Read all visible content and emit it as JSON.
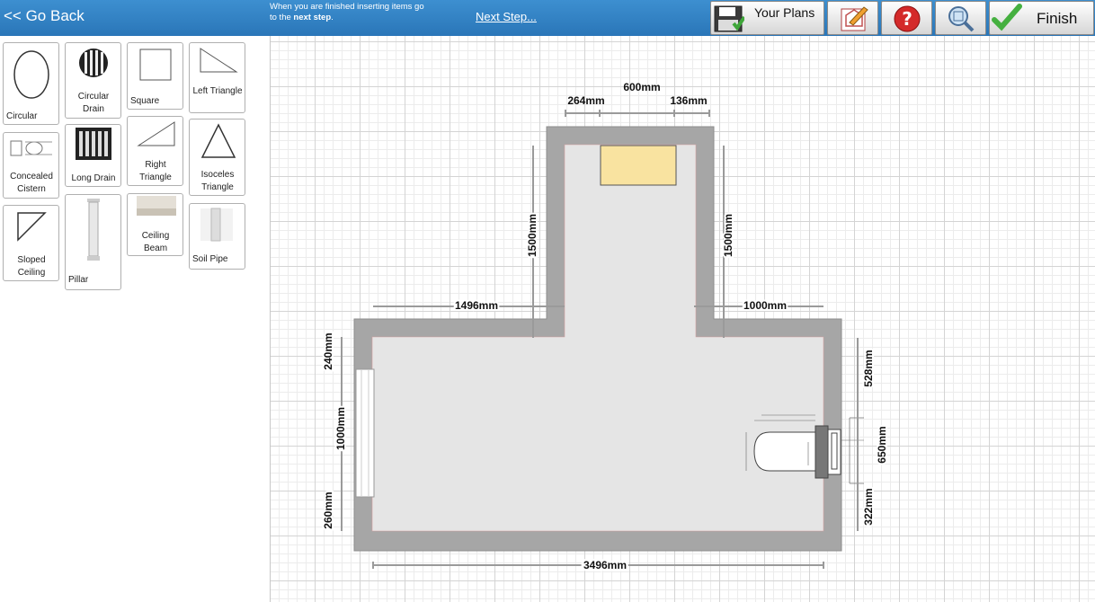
{
  "topbar": {
    "go_back": "<< Go Back",
    "hint_line1": "When you are finished inserting items go",
    "hint_line2_prefix": "to the ",
    "hint_line2_bold": "next step",
    "hint_line2_suffix": ".",
    "next_step": "Next Step...",
    "your_plans": "Your Plans",
    "finish": "Finish"
  },
  "sidebar": {
    "items": [
      {
        "label": "Circular"
      },
      {
        "label": "Circular Drain"
      },
      {
        "label": "Square"
      },
      {
        "label": "Left Triangle"
      },
      {
        "label": "Concealed Cistern"
      },
      {
        "label": "Long Drain"
      },
      {
        "label": "Right Triangle"
      },
      {
        "label": "Isoceles Triangle"
      },
      {
        "label": "Sloped Ceiling"
      },
      {
        "label": "Pillar"
      },
      {
        "label": "Ceiling Beam"
      },
      {
        "label": "Soil Pipe"
      }
    ]
  },
  "plan": {
    "dimensions": {
      "top_overall": "600mm",
      "top_left_offset": "264mm",
      "top_right_offset": "136mm",
      "left_upper_wall": "1500mm",
      "right_upper_wall": "1500mm",
      "left_step": "1496mm",
      "right_step": "1000mm",
      "left_top": "240mm",
      "left_window": "1000mm",
      "left_bottom": "260mm",
      "right_top": "528mm",
      "right_item": "650mm",
      "right_bottom": "322mm",
      "bottom_overall": "3496mm"
    }
  },
  "colors": {
    "topbar": "#2f7fc1",
    "wall": "#a6a6a6",
    "floor": "#e6e6e6",
    "placed_item": "#f9e3a0"
  },
  "icons": [
    "floppy-disk-icon",
    "edit-plan-icon",
    "help-icon",
    "zoom-icon",
    "checkmark-icon"
  ]
}
